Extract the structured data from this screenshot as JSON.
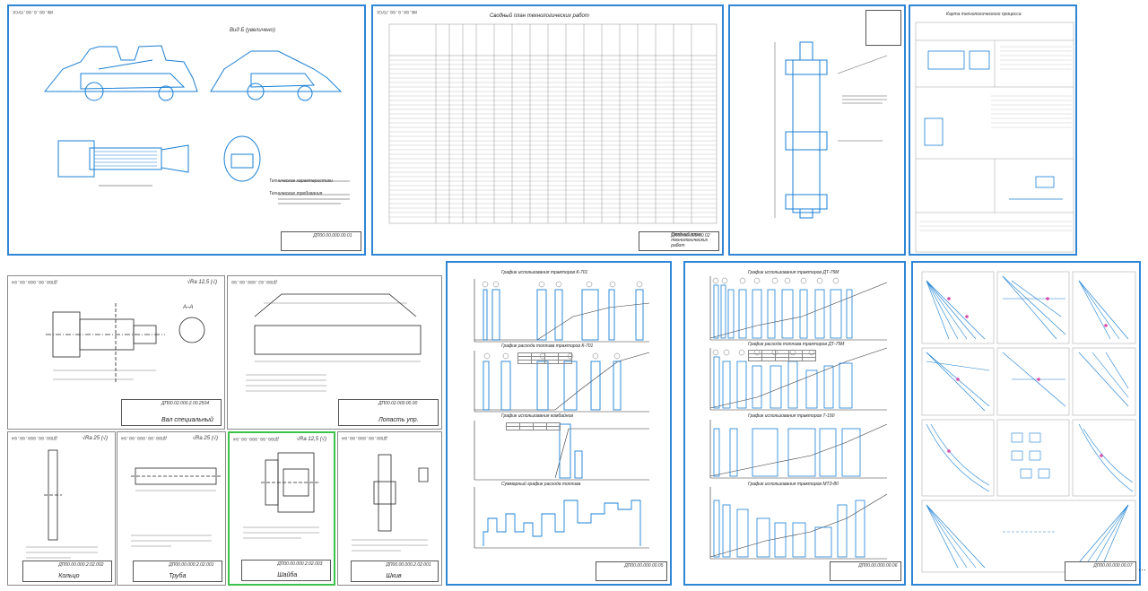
{
  "drawings": {
    "s1": {
      "frame_code": "ИЖ.00.0.00.ПУСК",
      "view_label": "Вид Б (увеличено)",
      "spec_title": "Технические характеристики",
      "spec_title2": "Технические требования",
      "titleblock_code": "ДП00.00.000.00.01",
      "titleblock_name": ""
    },
    "s2": {
      "frame_code": "ИЖ.00.0.00.ПУСК",
      "table_title": "Сводный план технологических работ",
      "titleblock_code": "ДП00.00.000.00.02",
      "titleblock_name": "Сводный план технологических работ"
    },
    "s3": {
      "frame_code": "",
      "titleblock_code": "",
      "titleblock_name": ""
    },
    "s4": {
      "header": "Карта технологического процесса",
      "titleblock_code": ""
    },
    "s5": {
      "frame_code": "ДП00.00.000.00.04",
      "section_label": "А–А",
      "roughness": "√Ra 12,5 (√)",
      "titleblock_code": "ДП00.02.000.2.00.2504",
      "titleblock_name": "Вал специальный"
    },
    "s6": {
      "frame_code": "ДП00.02.000.00.00",
      "titleblock_code": "ДП00.02.000.00.00",
      "titleblock_name": "Лопасть упр."
    },
    "s7": {
      "frame_code": "ДП00.00.000.00.04",
      "roughness": "√Ra 25 (√)",
      "titleblock_code": "ДП00.00.000.2.02.002",
      "titleblock_name": "Кольцо"
    },
    "s8": {
      "frame_code": "ДП00.00.000.00.04",
      "roughness": "√Ra 25 (√)",
      "titleblock_code": "ДП00.00.000.2.02.001",
      "titleblock_name": "Труба"
    },
    "s9": {
      "frame_code": "ДП00.00.000.00.04",
      "roughness": "√Ra 12,5 (√)",
      "titleblock_code": "ДП00.00.000.2.02.003",
      "titleblock_name": "Шайба"
    },
    "s10": {
      "frame_code": "ДП00.00.000.00.04",
      "titleblock_code": "ДП00.00.000.2.02.001",
      "titleblock_name": "Шкив"
    },
    "s11": {
      "chart_titles": [
        "График использования тракторов К-701",
        "График расхода топлива тракторов К-701",
        "График использования комбайнов",
        "Суммарный график расхода топлива"
      ],
      "titleblock_code": "ДП00.00.000.00.05"
    },
    "s12": {
      "chart_titles": [
        "График использования тракторов ДТ-75М",
        "График расхода топлива тракторов ДТ-75М",
        "График использования тракторов Т-150",
        "График использования тракторов МТЗ-80"
      ],
      "titleblock_code": "ДП00.00.000.00.06"
    },
    "s13": {
      "titleblock_code": "ДП00.00.000.00.07"
    }
  },
  "trailing": "…",
  "colors": {
    "accent": "#2f86d6",
    "selected": "#3cc24a",
    "line": "#1a7fd4"
  }
}
